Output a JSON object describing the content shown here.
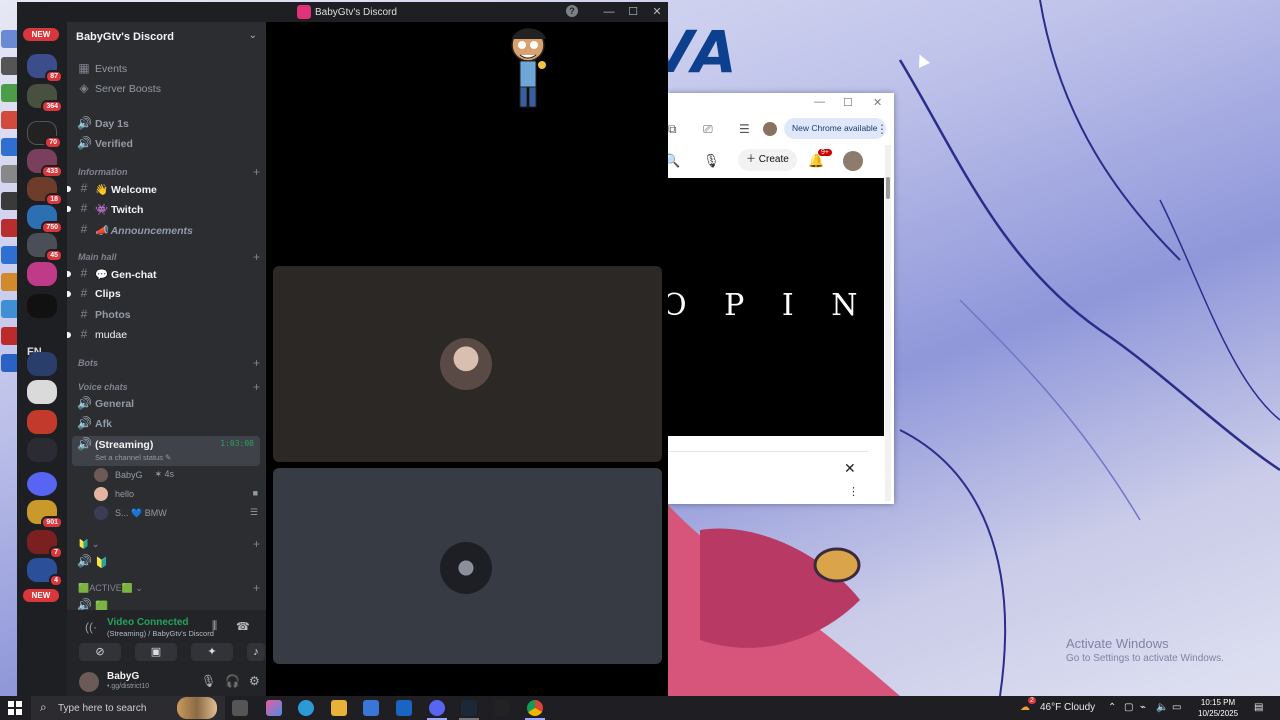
{
  "discord": {
    "title": "BabyGtv's Discord",
    "help_icon": "?",
    "window_controls": [
      "—",
      "☐",
      "✕"
    ],
    "rail": {
      "new_top": "NEW",
      "new_bottom": "NEW",
      "badges": [
        "87",
        "364",
        "70",
        "433",
        "18",
        "750",
        "45",
        "901",
        "7",
        "4"
      ],
      "fn_label": "FN"
    },
    "guild_name": "BabyGtv's Discord",
    "sidebar": {
      "top_items": [
        {
          "icon": "calendar-icon",
          "label": "Events"
        },
        {
          "icon": "boost-icon",
          "label": "Server Boosts"
        }
      ],
      "voice_day": "Day 1s",
      "voice_verified": "Verified",
      "cat_information": "Information",
      "ch_welcome": "👋 Welcome",
      "ch_twitch": "👾 Twitch",
      "ch_announcements": "📣 Announcements",
      "cat_main_hall": "Main hall",
      "ch_gen_chat": "💬 Gen-chat",
      "ch_clips": "Clips",
      "ch_photos": "Photos",
      "ch_mudae": "mudae",
      "cat_bots": "Bots",
      "cat_voice": "Voice chats",
      "vc_general": "General",
      "vc_afk": "Afk",
      "vc_streaming": "(Streaming)",
      "vc_streaming_timer": "1:03:08",
      "vc_streaming_status": "Set a channel status ✎",
      "users": [
        {
          "name": "BabyG",
          "extra": "✶ 4s"
        },
        {
          "name": "hello",
          "extra": "■"
        },
        {
          "name": "S...  💙 BMW",
          "extra": "☰"
        }
      ],
      "cat_unnamed": "🔰 ⌄",
      "vc_unnamed": "🔰",
      "cat_active": "🟩ACTIVE🟩 ⌄",
      "vc_active": "🟩"
    },
    "voice_panel": {
      "status": "Video Connected",
      "subtitle": "(Streaming) / BabyGtv's Discord"
    },
    "user": {
      "name": "BabyG",
      "status": "•.gg/district10"
    },
    "stage": {
      "deco_text": "COVA"
    }
  },
  "chrome": {
    "window_controls": [
      "—",
      "☐",
      "✕"
    ],
    "new_chrome_label": "New Chrome available",
    "create_label": "Create",
    "notif_badge": "9+",
    "video_text": "O P I N"
  },
  "desktop": {
    "activate_title": "Activate Windows",
    "activate_sub": "Go to Settings to activate Windows."
  },
  "taskbar": {
    "search_placeholder": "Type here to search",
    "weather": "46°F  Cloudy",
    "weather_badge": "2",
    "time": "10:15 PM",
    "date": "10/25/2025"
  }
}
